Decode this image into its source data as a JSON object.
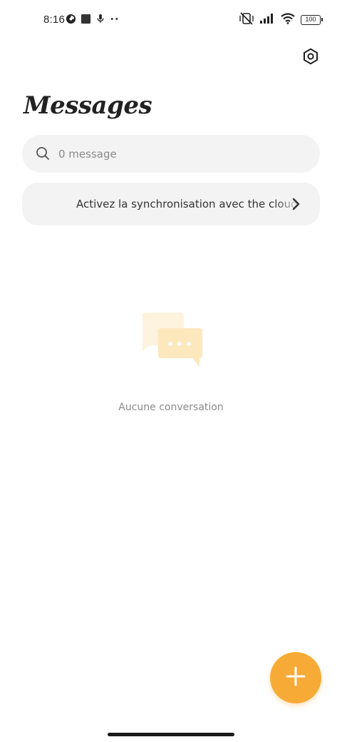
{
  "status_bar": {
    "time": "8:16",
    "battery": "100",
    "icons": [
      "data-saver-icon",
      "square-notification-icon",
      "microphone-icon",
      "more-dots-icon",
      "vibrate-off-icon",
      "signal-icon",
      "wifi-icon",
      "battery-icon"
    ]
  },
  "header": {
    "title": "Messages",
    "settings_icon": "settings-hexagon-icon"
  },
  "search": {
    "placeholder": "0 message",
    "value": ""
  },
  "sync_banner": {
    "text": "Activez la synchronisation avec the cloud pour sauvegarder vos messages"
  },
  "empty_state": {
    "text": "Aucune conversation"
  },
  "fab": {
    "icon": "plus-icon"
  },
  "colors": {
    "accent": "#f7ab36",
    "surface": "#f3f3f3",
    "illustration_back": "#fdf3df",
    "illustration_front": "#fde7bd"
  }
}
